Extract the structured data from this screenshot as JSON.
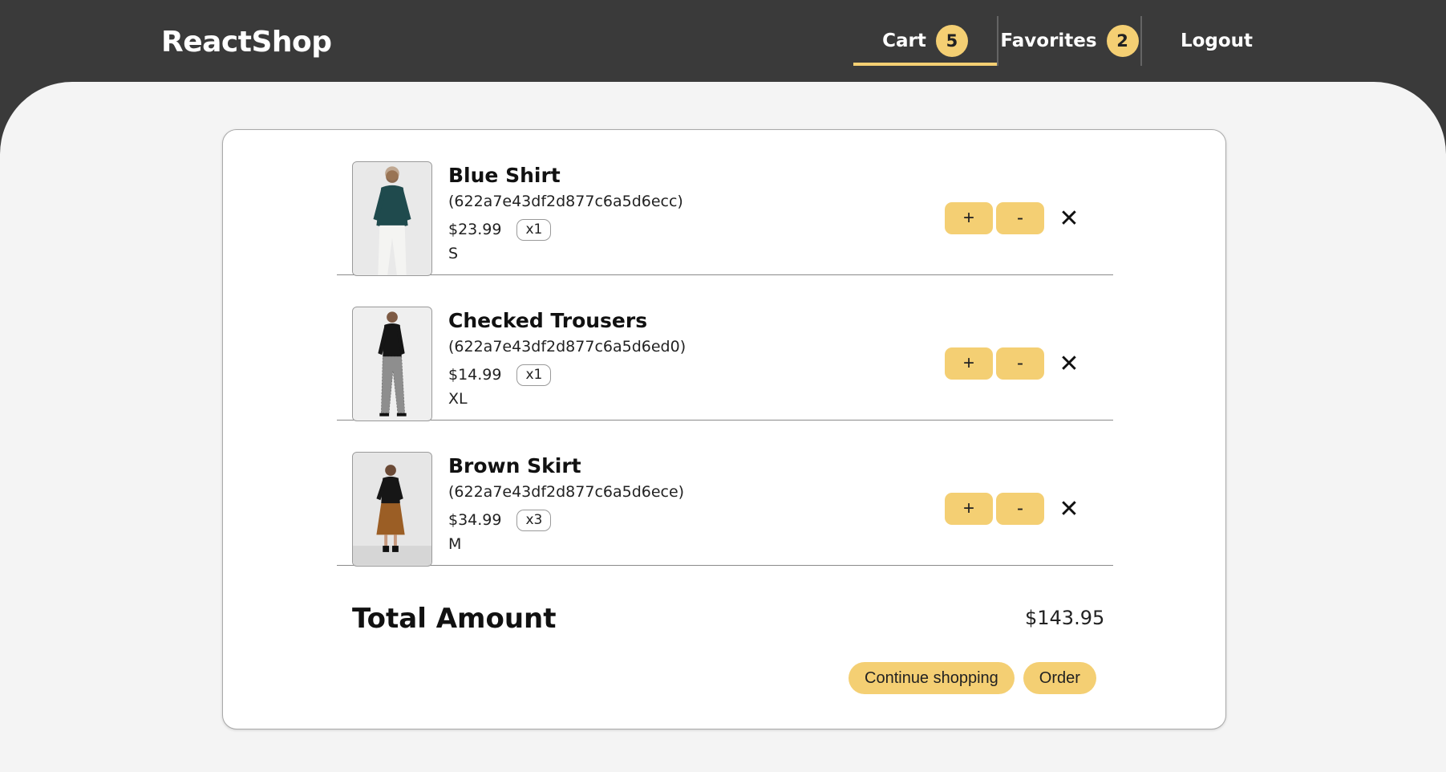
{
  "header": {
    "brand": "ReactShop",
    "nav": {
      "cart_label": "Cart",
      "cart_count": "5",
      "favorites_label": "Favorites",
      "favorites_count": "2",
      "logout_label": "Logout"
    }
  },
  "cart": {
    "items": [
      {
        "name": "Blue Shirt",
        "id": "(622a7e43df2d877c6a5d6ecc)",
        "price": "$23.99",
        "qty": "x1",
        "size": "S"
      },
      {
        "name": "Checked Trousers",
        "id": "(622a7e43df2d877c6a5d6ed0)",
        "price": "$14.99",
        "qty": "x1",
        "size": "XL"
      },
      {
        "name": "Brown Skirt",
        "id": "(622a7e43df2d877c6a5d6ece)",
        "price": "$34.99",
        "qty": "x3",
        "size": "M"
      }
    ],
    "increase_label": "+",
    "decrease_label": "-",
    "remove_label": "✕",
    "total_label": "Total Amount",
    "total_value": "$143.95",
    "continue_label": "Continue shopping",
    "order_label": "Order"
  },
  "colors": {
    "header_bg": "#3a3a3a",
    "accent": "#f4cf73",
    "page_bg": "#f4f4f4"
  }
}
